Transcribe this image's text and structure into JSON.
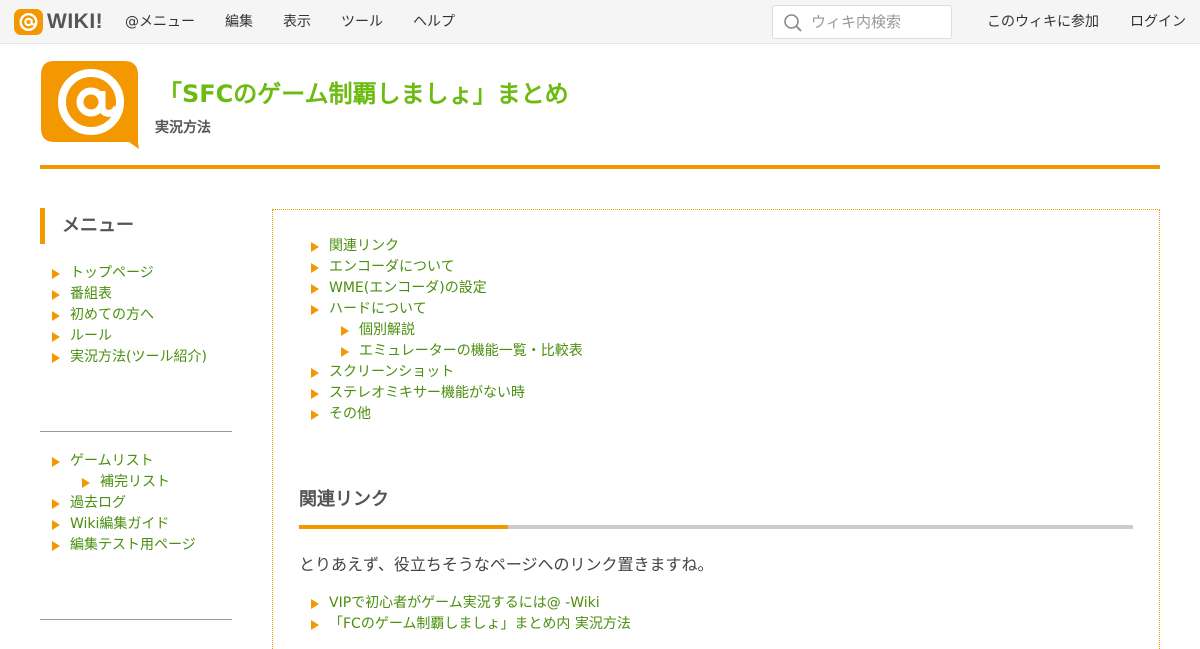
{
  "topbar": {
    "logo_text": "WIKI!",
    "nav": [
      "@メニュー",
      "編集",
      "表示",
      "ツール",
      "ヘルプ"
    ],
    "search_placeholder": "ウィキ内検索",
    "join": "このウィキに参加",
    "login": "ログイン"
  },
  "header": {
    "title": "「SFCのゲーム制覇しましょ」まとめ",
    "subtitle": "実況方法"
  },
  "sidebar": {
    "heading": "メニュー",
    "group1": [
      "トップページ",
      "番組表",
      "初めての方へ",
      "ルール",
      "実況方法(ツール紹介)"
    ],
    "group2": [
      {
        "label": "ゲームリスト",
        "level": 0
      },
      {
        "label": "補完リスト",
        "level": 1
      },
      {
        "label": "過去ログ",
        "level": 0
      },
      {
        "label": "Wiki編集ガイド",
        "level": 0
      },
      {
        "label": "編集テスト用ページ",
        "level": 0
      }
    ]
  },
  "content": {
    "toc": [
      {
        "label": "関連リンク",
        "level": 0
      },
      {
        "label": "エンコーダについて",
        "level": 0
      },
      {
        "label": "WME(エンコーダ)の設定",
        "level": 0
      },
      {
        "label": "ハードについて",
        "level": 0
      },
      {
        "label": "個別解説",
        "level": 1
      },
      {
        "label": "エミュレーターの機能一覧・比較表",
        "level": 1
      },
      {
        "label": "スクリーンショット",
        "level": 0
      },
      {
        "label": "ステレオミキサー機能がない時",
        "level": 0
      },
      {
        "label": "その他",
        "level": 0
      }
    ],
    "section_title": "関連リンク",
    "section_text": "とりあえず、役立ちそうなページへのリンク置きますね。",
    "links": [
      "VIPで初心者がゲーム実況するには@ -Wiki",
      "「FCのゲーム制覇しましょ」まとめ内 実況方法"
    ]
  },
  "colors": {
    "accent": "#f39800",
    "link": "#4a8f0e",
    "title": "#6cbb10"
  }
}
